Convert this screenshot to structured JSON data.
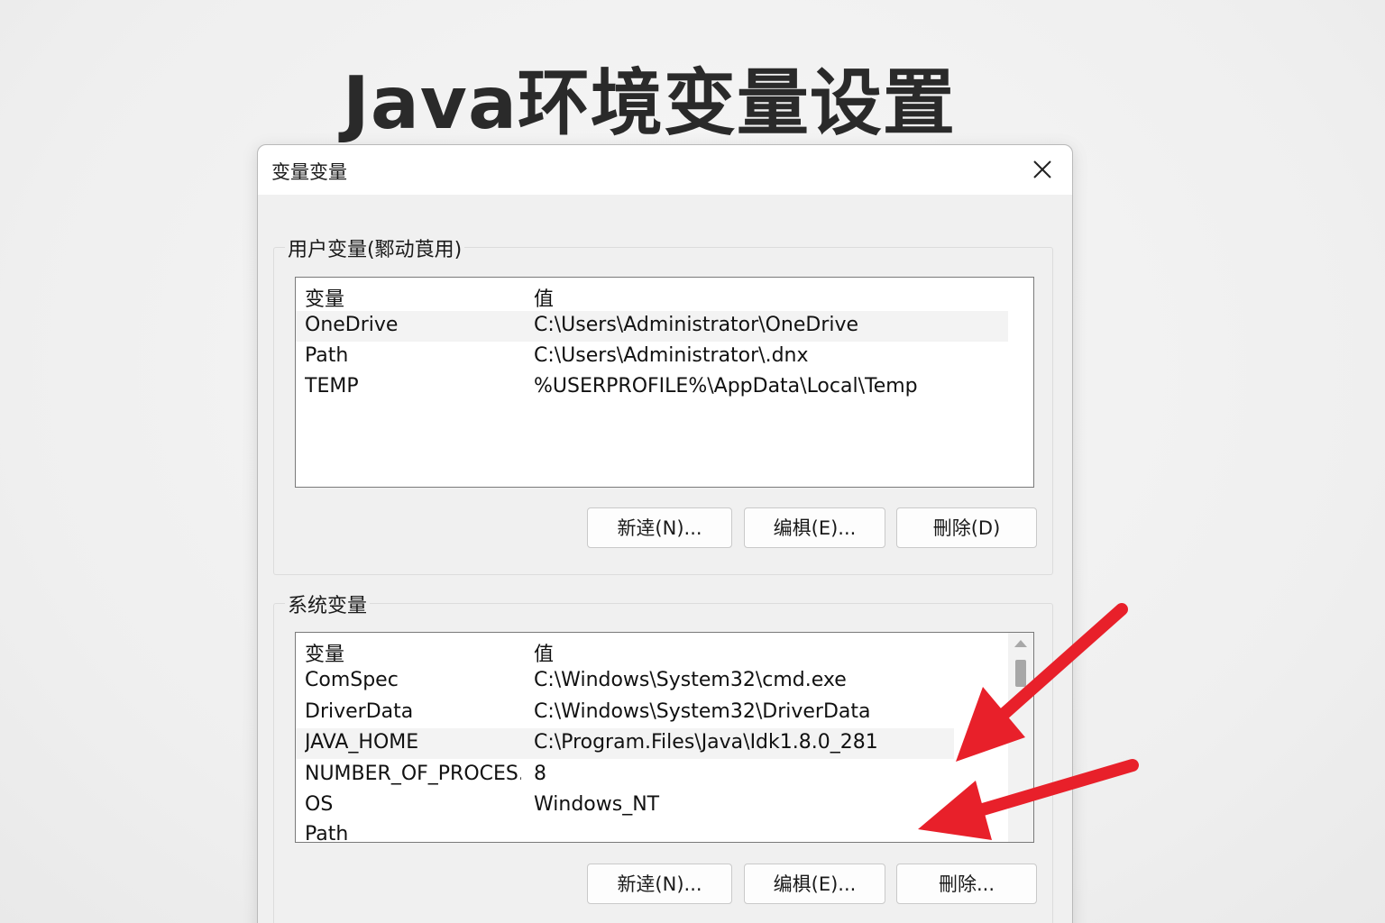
{
  "hero_title": "Java环境变量设置",
  "dialog": {
    "title": "变量变量",
    "close_glyph": "✕"
  },
  "user_vars": {
    "group_label": "用户变量(鄹动莨用)",
    "header": {
      "name": "变量",
      "value": "值"
    },
    "rows": [
      {
        "name": "OneDrive",
        "value": "C:\\Users\\Administrator\\OneDrive"
      },
      {
        "name": "Path",
        "value": "C:\\Users\\Administrator\\.dnx"
      },
      {
        "name": "TEMP",
        "value": "%USERPROFILE%\\AppData\\Local\\Temp"
      }
    ],
    "buttons": {
      "new": "新逹(N)...",
      "edit": "编椇(E)...",
      "delete": "刪除(D)"
    }
  },
  "system_vars": {
    "group_label": "系统变量",
    "header": {
      "name": "变量",
      "value": "值"
    },
    "rows": [
      {
        "name": "ComSpec",
        "value": "C:\\Windows\\System32\\cmd.exe"
      },
      {
        "name": "DriverData",
        "value": "C:\\Windows\\System32\\DriverData"
      },
      {
        "name": "JAVA_HOME",
        "value": "C:\\Program.Files\\Java\\Idk1.8.0_281"
      },
      {
        "name": "NUMBER_OF_PROCES...",
        "value": "8"
      },
      {
        "name": "OS",
        "value": "Windows_NT"
      },
      {
        "name": "Path",
        "value": ""
      }
    ],
    "buttons": {
      "new": "新逹(N)...",
      "edit": "编椇(E)...",
      "delete": "刪除..."
    }
  },
  "colors": {
    "arrow": "#e8202a",
    "title": "#2a2a2a",
    "dialog_bg": "#f0f0f0"
  }
}
